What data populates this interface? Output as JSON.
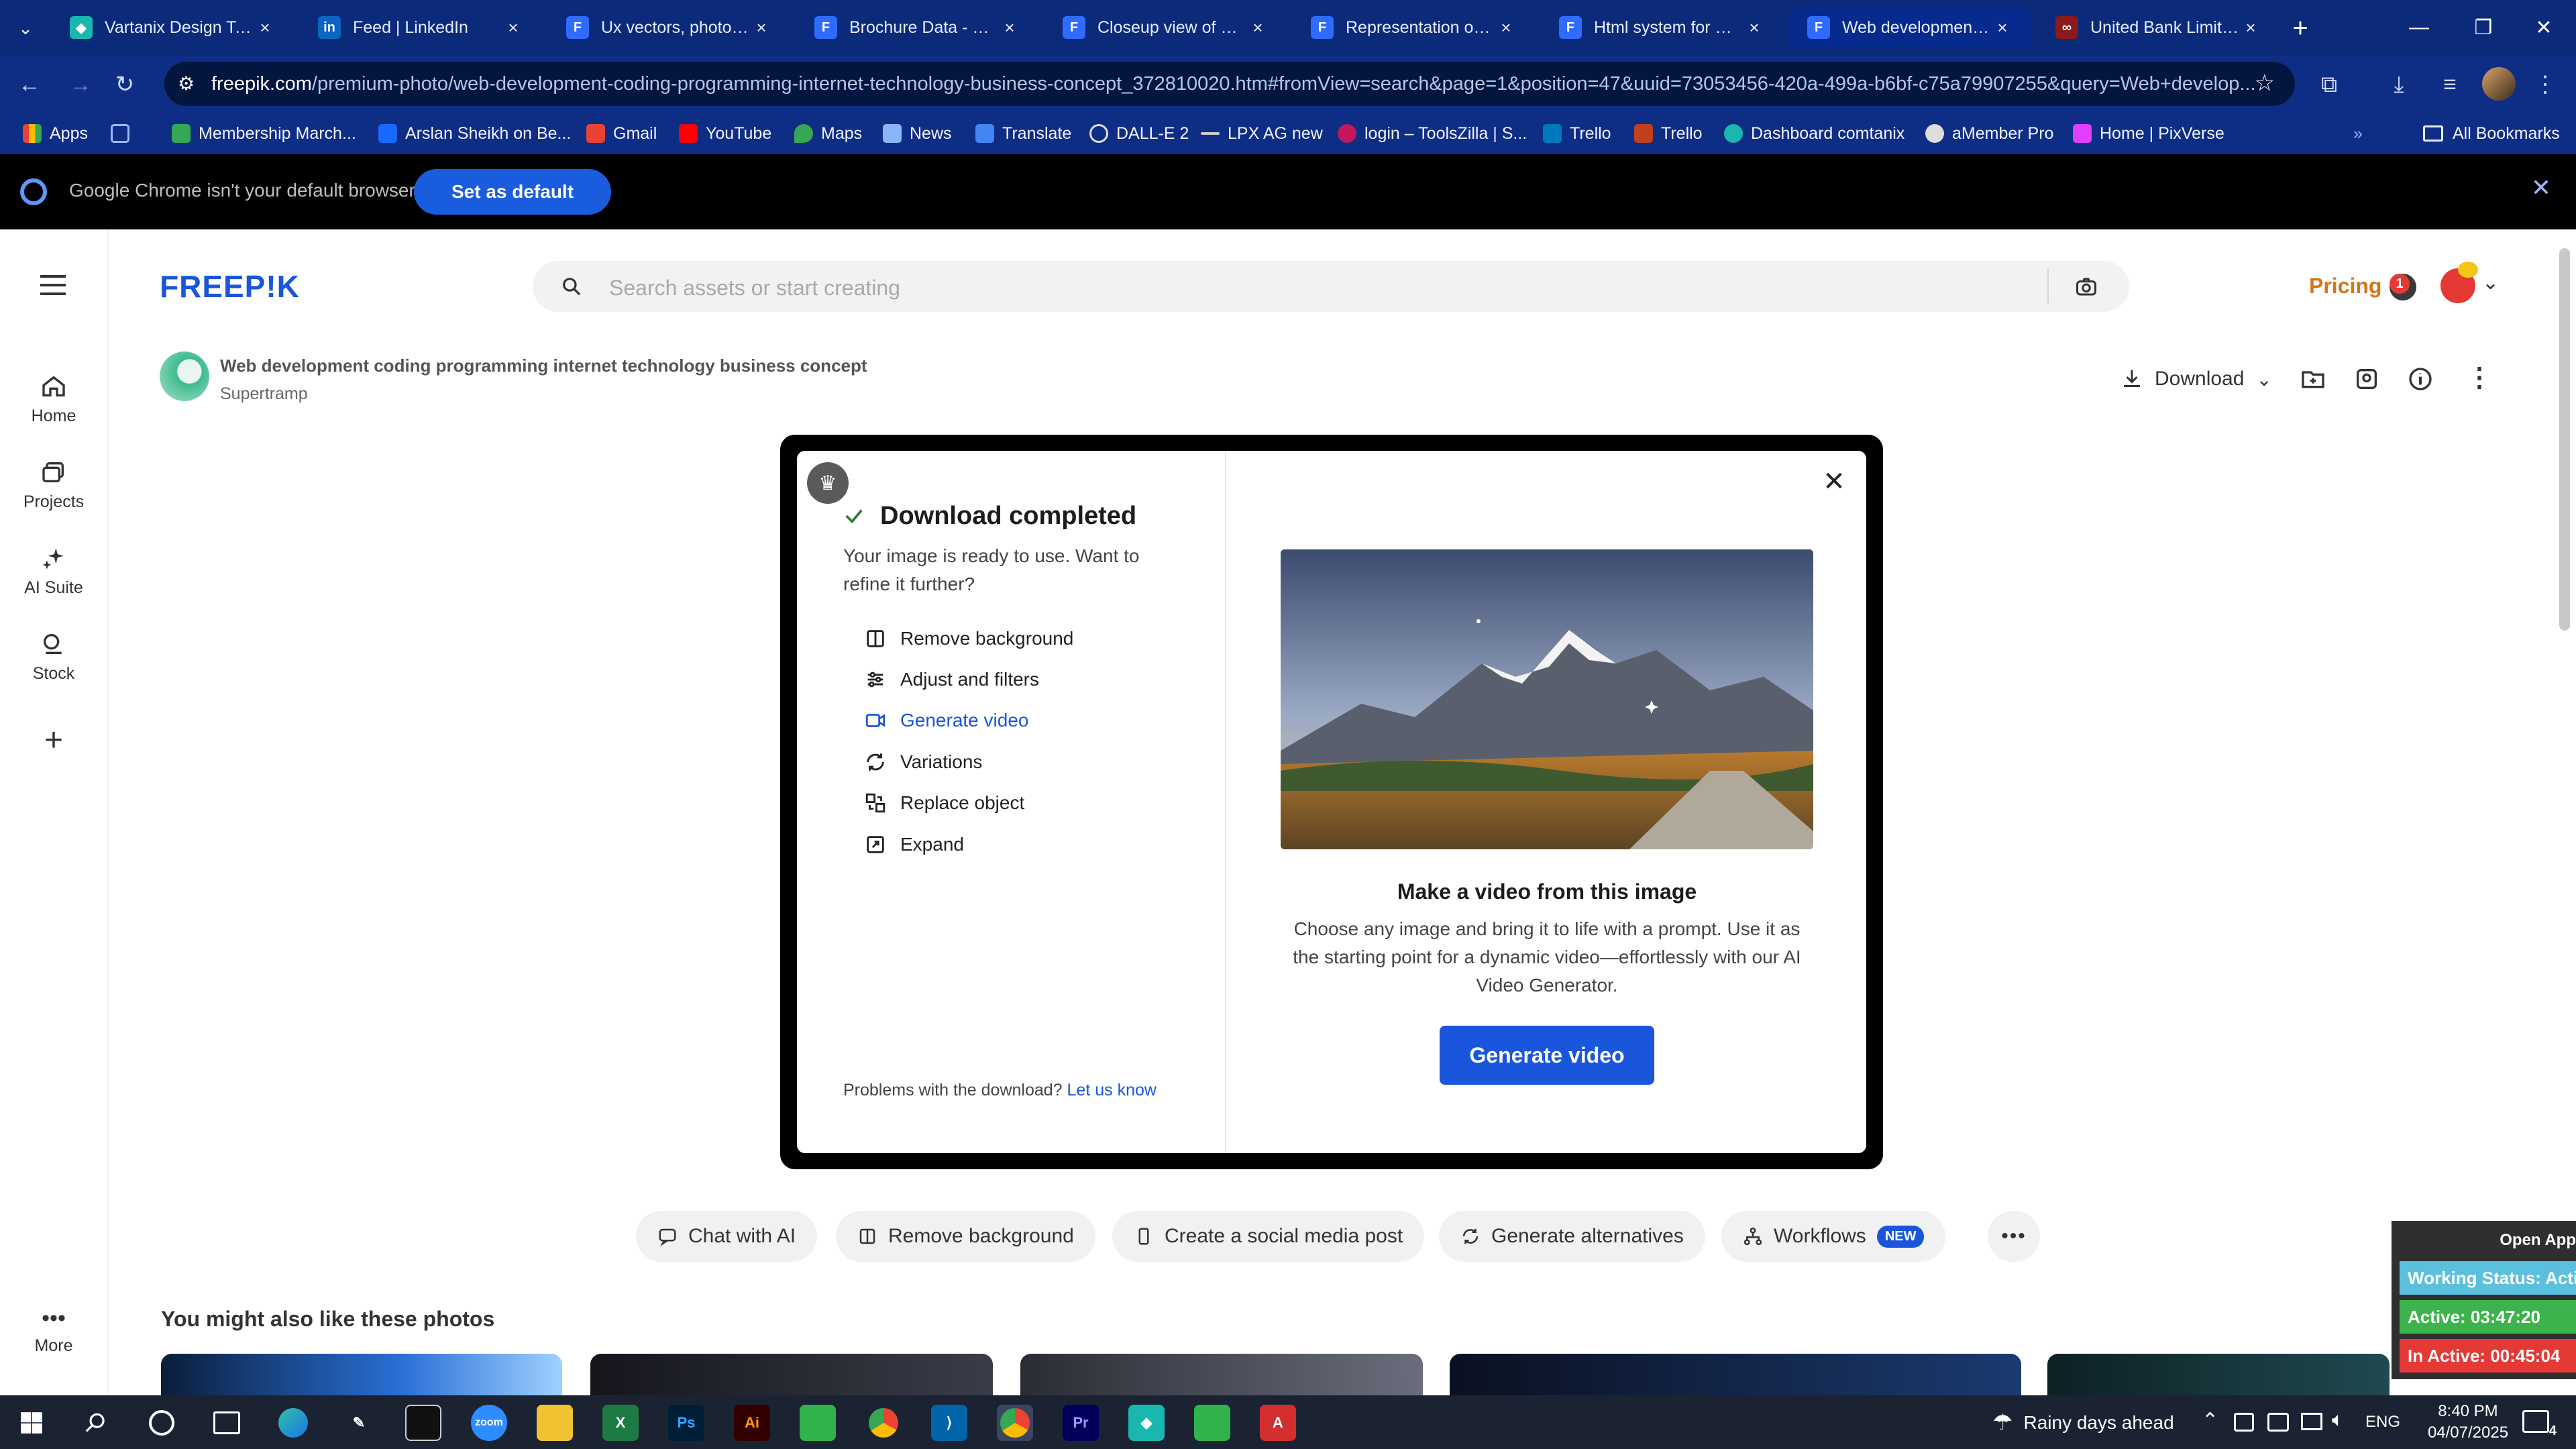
{
  "browser": {
    "tabs": [
      {
        "label": "Vartanix Design Tasks",
        "icon": "vartanix-icon"
      },
      {
        "label": "Feed | LinkedIn",
        "icon": "linkedin-icon"
      },
      {
        "label": "Ux vectors, photos an",
        "icon": "freepik-icon"
      },
      {
        "label": "Brochure Data - Goo",
        "icon": "freepik-icon"
      },
      {
        "label": "Closeup view of a ha",
        "icon": "freepik-icon"
      },
      {
        "label": "Representation of us",
        "icon": "freepik-icon"
      },
      {
        "label": "Html system for web",
        "icon": "freepik-icon"
      },
      {
        "label": "Web development co",
        "icon": "freepik-icon"
      },
      {
        "label": "United Bank Limited",
        "icon": "ubl-icon"
      }
    ],
    "url_host": "freepik.com",
    "url_path": "/premium-photo/web-development-coding-programming-internet-technology-business-concept_372810020.htm#fromView=search&page=1&position=47&uuid=73053456-420a-499a-b6bf-c75a79907255&query=Web+develop...",
    "bookmarks": [
      "Apps",
      "Membership March...",
      "Arslan Sheikh on Be...",
      "Gmail",
      "YouTube",
      "Maps",
      "News",
      "Translate",
      "DALL-E 2",
      "LPX AG new",
      "login – ToolsZilla | S...",
      "Trello",
      "Trello",
      "Dashboard comtanix",
      "aMember Pro",
      "Home | PixVerse"
    ],
    "all_bookmarks": "All Bookmarks",
    "infobar": {
      "message": "Google Chrome isn't your default browser",
      "button": "Set as default"
    }
  },
  "rail": {
    "items": [
      "Home",
      "Projects",
      "AI Suite",
      "Stock"
    ],
    "more": "More"
  },
  "header": {
    "logo": "FREEP!K",
    "search_placeholder": "Search assets or start creating",
    "pricing": "Pricing",
    "notification_count": "1"
  },
  "asset": {
    "title": "Web development coding programming internet technology business concept",
    "author": "Supertramp",
    "download_label": "Download"
  },
  "modal": {
    "title": "Download completed",
    "subtitle": "Your image is ready to use. Want to refine it further?",
    "options": [
      "Remove background",
      "Adjust and filters",
      "Generate video",
      "Variations",
      "Replace object",
      "Expand"
    ],
    "problems_text": "Problems with the download?",
    "problems_link": "Let us know",
    "promo_title": "Make a video from this image",
    "promo_body": "Choose any image and bring it to life with a prompt. Use it as the starting point for a dynamic video—effortlessly with our AI Video Generator.",
    "promo_button": "Generate video"
  },
  "actions": {
    "chips": [
      "Chat with AI",
      "Remove background",
      "Create a social media post",
      "Generate alternatives",
      "Workflows"
    ],
    "new_badge": "NEW"
  },
  "related": {
    "heading": "You might also like these photos"
  },
  "tracker": {
    "open_app": "Open App",
    "working_status": "Working Status: Active",
    "active": "Active: 03:47:20",
    "inactive": "In Active: 00:45:04"
  },
  "taskbar": {
    "weather": "Rainy days ahead",
    "language": "ENG",
    "time": "8:40 PM",
    "date": "04/07/2025",
    "notifications": "4"
  },
  "colors": {
    "accent": "#1a56db",
    "pricing": "#d4761a",
    "tab_strip": "#0b2a7a"
  }
}
